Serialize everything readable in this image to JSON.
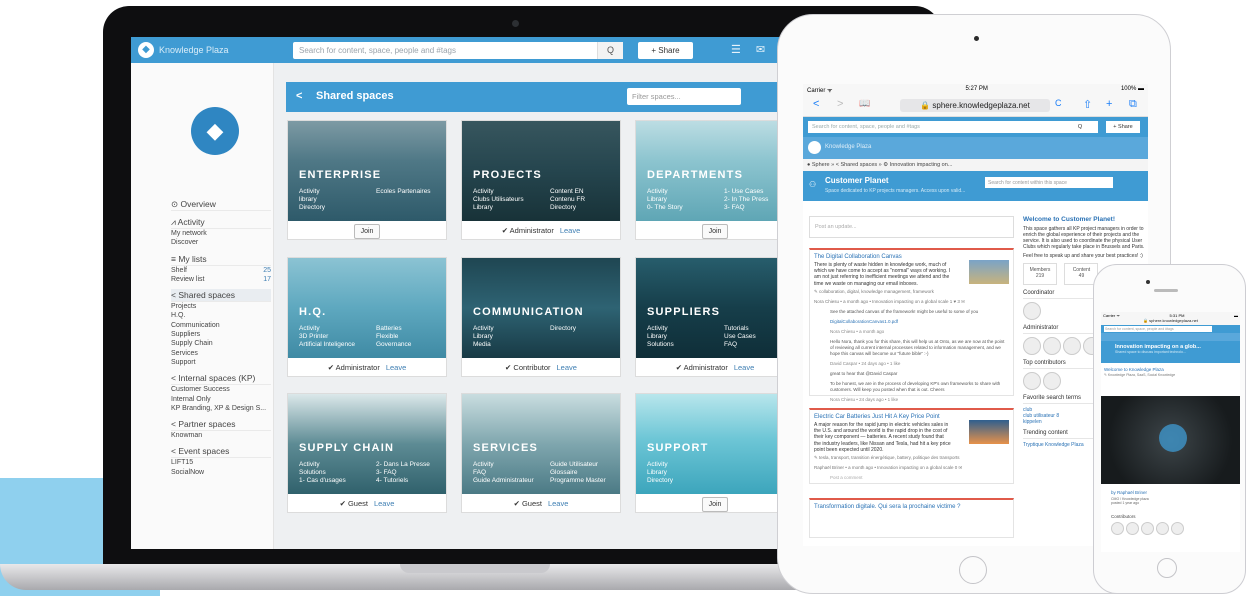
{
  "laptop": {
    "app_name": "Knowledge Plaza",
    "search_placeholder": "Search for content, space, people and #tags",
    "search_button": "Q",
    "share_button": "+  Share",
    "topbar_icons": "☰ ✉",
    "sidebar": {
      "overview": "⊙ Overview",
      "activity": "⩘ Activity",
      "activity_items": [
        "My network",
        "Discover"
      ],
      "my_lists": "≡ My lists",
      "lists": [
        {
          "label": "Shelf",
          "count": "25"
        },
        {
          "label": "Review list",
          "count": "17"
        }
      ],
      "shared_spaces": "< Shared spaces",
      "shared_items": [
        "Projects",
        "H.Q.",
        "Communication",
        "Suppliers",
        "Supply Chain",
        "Services",
        "Support"
      ],
      "internal_spaces": "< Internal spaces (KP)",
      "internal_items": [
        "Customer Success",
        "Internal Only",
        "KP Branding, XP & Design S..."
      ],
      "partner_spaces": "< Partner spaces",
      "partner_items": [
        "Knowman"
      ],
      "event_spaces": "< Event spaces",
      "event_items": [
        "LIFT15",
        "SocialNow"
      ]
    },
    "content_title": "Shared spaces",
    "filter_placeholder": "Filter spaces...",
    "cards": [
      {
        "title": "ENTERPRISE",
        "left": [
          "Activity",
          "library",
          "Directory"
        ],
        "right": [
          "Ecoles Partenaires",
          "",
          ""
        ],
        "footer": "Join",
        "type": "join"
      },
      {
        "title": "PROJECTS",
        "left": [
          "Activity",
          "Clubs Utilisateurs",
          "Library"
        ],
        "right": [
          "Content EN",
          "Contenu FR",
          "Directory"
        ],
        "role": "✔ Administrator",
        "leave": "Leave",
        "type": "role"
      },
      {
        "title": "DEPARTMENTS",
        "left": [
          "Activity",
          "Library",
          "0- The Story"
        ],
        "right": [
          "1- Use Cases",
          "2- In The Press",
          "3- FAQ"
        ],
        "footer": "Join",
        "type": "join"
      },
      {
        "title": "H.Q.",
        "left": [
          "Activity",
          "3D Printer",
          "Artificial Inteligence"
        ],
        "right": [
          "Batteries",
          "Flexible",
          "Governance"
        ],
        "role": "✔ Administrator",
        "leave": "Leave",
        "type": "role"
      },
      {
        "title": "COMMUNICATION",
        "left": [
          "Activity",
          "Library",
          "Media"
        ],
        "right": [
          "Directory",
          "",
          ""
        ],
        "role": "✔ Contributor",
        "leave": "Leave",
        "type": "role"
      },
      {
        "title": "SUPPLIERS",
        "left": [
          "Activity",
          "Library",
          "Solutions"
        ],
        "right": [
          "Tutorials",
          "Use Cases",
          "FAQ"
        ],
        "role": "✔ Administrator",
        "leave": "Leave",
        "type": "role"
      },
      {
        "title": "SUPPLY CHAIN",
        "left": [
          "Activity",
          "Solutions",
          "1- Cas d'usages"
        ],
        "right": [
          "2- Dans La Presse",
          "3- FAQ",
          "4- Tutoriels"
        ],
        "role": "✔ Guest",
        "leave": "Leave",
        "type": "role"
      },
      {
        "title": "SERVICES",
        "left": [
          "Activity",
          "FAQ",
          "Guide Administrateur"
        ],
        "right": [
          "Guide Utilisateur",
          "Glossaire",
          "Programme Master"
        ],
        "role": "✔ Guest",
        "leave": "Leave",
        "type": "role"
      },
      {
        "title": "SUPPORT",
        "left": [
          "Activity",
          "Library",
          "Directory"
        ],
        "right": [
          "",
          "",
          ""
        ],
        "footer": "Join",
        "type": "join"
      }
    ]
  },
  "tablet": {
    "status_left": "Carrier ᯤ",
    "status_time": "5:27 PM",
    "status_right": "100% ▬",
    "url": "🔒 sphere.knowledgeplaza.net",
    "nav_back": "<",
    "nav_fwd": ">",
    "nav_book": "📖",
    "nav_reload": "C",
    "nav_share": "⇧",
    "nav_plus": "+",
    "nav_tabs": "⧉",
    "search_placeholder": "Search for content, space, people and #tags",
    "search_button": "Q",
    "share_button": "+ Share",
    "app_name": "Knowledge Plaza",
    "breadcrumb": "● Sphere » < Shared spaces » ⚙ Innovation impacting on...",
    "space_title": "Customer Planet",
    "space_desc": "Space dedicated to KP projects managers. Access upon valid...",
    "space_search": "Search for content within this space",
    "post_placeholder": "Post an update...",
    "items": [
      {
        "title": "The Digital Collaboration Canvas",
        "body": "There is plenty of waste hidden in knowledge work, much of which we have come to accept as \"normal\" ways of working. I am not just referring to inefficient meetings we attend and the time we waste on managing our email inboxes.",
        "tags": "✎ collaboration, digital, knowledge management, framework",
        "meta": "Nora Chiesu • a month ago • Innovation impacting on a global scale   1 ♥  3 ✉",
        "comments": [
          "See the attached canvas of the framework! might be useful to some of you",
          "DigitalCollaborationCanvas1.0.pdf",
          "Nora Chiesu • a month ago",
          "Hello Nora, thank you for this share, this will help us at Onto, as we are now at the point of reviewing all current internal processes related to information management, and we hope this canvas will become our \"future bible\" :-)",
          "David Caspar • 24 days ago • 1 like",
          "great to hear that @David Caspar",
          "To be honest, we are in the process of developing KP's own frameworks to share with customers. Will keep you posted when that is out. Cheers",
          "Nora Chiesu • 24 days ago • 1 like",
          "Post a comment"
        ]
      },
      {
        "title": "Electric Car Batteries Just Hit A Key Price Point",
        "body": "A major reason for the rapid jump in electric vehicles sales in the U.S. and around the world is the rapid drop in the cost of their key component — batteries. A recent study found that the industry leaders, like Nissan and Tesla, had hit a key price point been expected until 2020.",
        "tags": "✎ tesla, transport, transition énergétique, battery, politique des transports",
        "meta": "Raphaël Briner • a month ago • Innovation impacting on a global scale   0 ✉",
        "comments": [
          "Post a comment"
        ]
      },
      {
        "title": "Transformation digitale. Qui sera la prochaine victime ?",
        "body": "",
        "tags": "",
        "meta": "",
        "comments": []
      }
    ],
    "welcome_title": "Welcome to Customer Planet!",
    "welcome_text": "This space gathers all KP project managers in order to enrich the global experience of their projects and the service. It is also used to coordinate the physical User Clubs which regularly take place in Brussels and Paris.",
    "welcome_text2": "Feel free to speak up and share your best practices! :)",
    "members_label": "Members",
    "members_count": "219",
    "content_label": "Content",
    "content_count": "49",
    "coordinator": "Coordinator",
    "administrator": "Administrator",
    "top_contributors": "Top contributors",
    "fav_search": "Favorite search terms",
    "fav_terms": [
      "club",
      "club utilisateur 8",
      "kippelen",
      "vers",
      "tags"
    ],
    "trending": "Trending content",
    "trending_item": "Tryptique Knowledge Plaza"
  },
  "phone": {
    "status_left": "Carrier ᯤ",
    "status_time": "5:31 PM",
    "url": "🔒 sphere.knowledgeplaza.net",
    "search_placeholder": "Search for content, space, people and #tags",
    "share": "+ Share",
    "space_title": "Innovation impacting on a glob...",
    "space_desc": "Shared space to discuss important technolo...",
    "welcome": "Welcome to Knowledge Plaza",
    "tags": "✎ Knowledge Plaza, SaaS, Social Knowledge",
    "author_by": "by Raphaël Briner",
    "author_role": "CMO / Knowledge plaza",
    "author_time": "posted 1 year ago",
    "contributors": "Contributors"
  }
}
